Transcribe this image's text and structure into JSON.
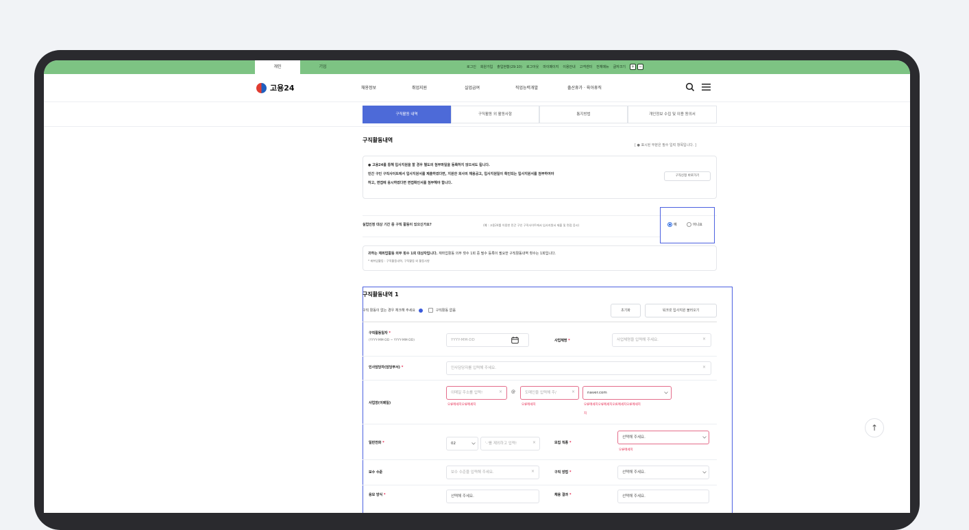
{
  "topbar": {
    "tab_personal": "개인",
    "tab_company": "기업",
    "links": [
      "로그인",
      "회원가입",
      "출입현황(29:10)",
      "로그아웃",
      "마이페이지",
      "이용안내",
      "고객센터",
      "전체메뉴",
      "글자크기"
    ],
    "font_plus": "+",
    "font_minus": "−"
  },
  "header": {
    "logo_text": "고용24",
    "nav": [
      "채용정보",
      "취업지원",
      "실업급여",
      "직업능력개발",
      "출산휴가 · 육아휴직"
    ]
  },
  "subtabs": [
    "구직활동 내역",
    "구직활동 외 활동사항",
    "통지방법",
    "개인정보 수집 및 이용 동의서"
  ],
  "section": {
    "title": "구직활동내역",
    "required_note": "[ ● 표시된 부분은 필수 입력 항목입니다. ]"
  },
  "info": {
    "line1": "● 고용24를 통해 입사지원을 할 경우 별도의 첨부파일을 등록하지 않으셔도 됩니다.",
    "line2": "민간 구인 구직사이트에서 입사지원서를 제출하였다면, 지원한 회사의 채용공고, 입사지원일이 확인되는 입사지원서를 첨부하여야",
    "line3": "하고, 면접에 응시하였다면 면접확인서를 첨부해야 합니다.",
    "button": "구직신청 바로가기"
  },
  "question": {
    "text": "실업인정 대상 기간 중 구직 활동이 있으신가요?",
    "example": "(예 : 고용24를 이용한 민간 구인 구직사이트에서 입사지원서 제출 및 면접 응시)",
    "yes": "예",
    "no": "아니요"
  },
  "notice": {
    "line1a": "귀하는 재취업활동 의무 횟수 1회 대상자입니다.",
    "line1b": "재취업활동 의무 횟수 1회 중 필수 등록이 필요한 구직활동내역 횟수는 1회입니다.",
    "line2": "* 재취업활동 : 구직활동내역, 구직활동 외 활동사항"
  },
  "record": {
    "title": "구직활동내역 1",
    "check_prompt": "구직 활동이 없는 경우 체크해 주세요",
    "checkbox_label": "구직활동 없음",
    "reset_button": "초기화",
    "load_button": "워크넷 입사지원 불러오기",
    "date_label": "구직활동일자",
    "date_format": "(YYYY-MM-DD ~ YYYY-MM-DD)",
    "date_placeholder": "YYYY-MM-DD",
    "company_label": "사업체명",
    "company_placeholder": "사업체명을 입력해 주세요.",
    "hr_label": "인사담당자(담당부서)",
    "hr_placeholder": "인사담당자를 입력해 주세요.",
    "email_label": "사업장(이메일)",
    "email_id_placeholder": "이메일 주소를 입력!",
    "at": "@",
    "domain_placeholder": "도메인을 입력해 주/",
    "domain_select": "naver.com",
    "email_err1": "오류메세지오류메세지",
    "email_err2": "오류메세지",
    "email_err3": "오류메세지오류메세지오류메세지오류메세지",
    "email_err3b": "지",
    "phone_label": "일반전화",
    "phone_area": "02",
    "phone_placeholder": "'-'를 제외하고 입력!",
    "job_label": "모집 직종",
    "job_placeholder": "선택해 주세요.",
    "job_err": "오류메세지",
    "salary_label": "보수 수준",
    "salary_placeholder": "보수 수준을 입력해 주세요.",
    "method_label": "구직 방법",
    "method_placeholder": "선택해 주세요.",
    "next_label1": "응모 방식",
    "next_ph1": "선택해 주세요.",
    "next_label2": "채용 결과",
    "next_ph2": "선택해 주세요."
  },
  "scroll_top": "↑"
}
